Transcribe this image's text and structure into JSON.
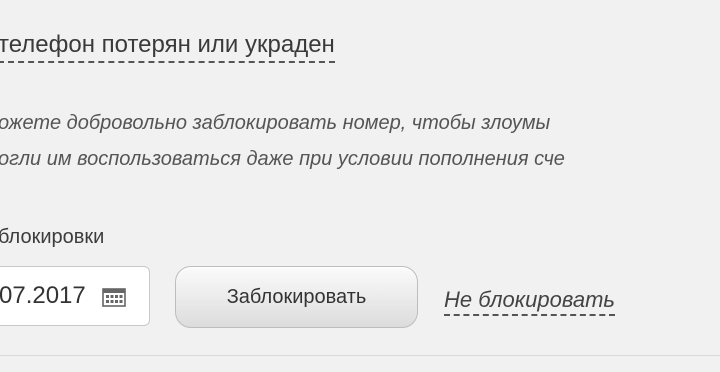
{
  "section": {
    "title": "телефон потерян или украден"
  },
  "description": {
    "line1": "ожете добровольно заблокировать номер, чтобы злоумы",
    "line2": "огли им воспользоваться даже при условии пополнения сче"
  },
  "block_form": {
    "date_label": "блокировки",
    "date_value": "07.2017",
    "date_icon": "calendar-icon",
    "block_button_label": "Заблокировать",
    "cancel_link_label": "Не блокировать"
  }
}
